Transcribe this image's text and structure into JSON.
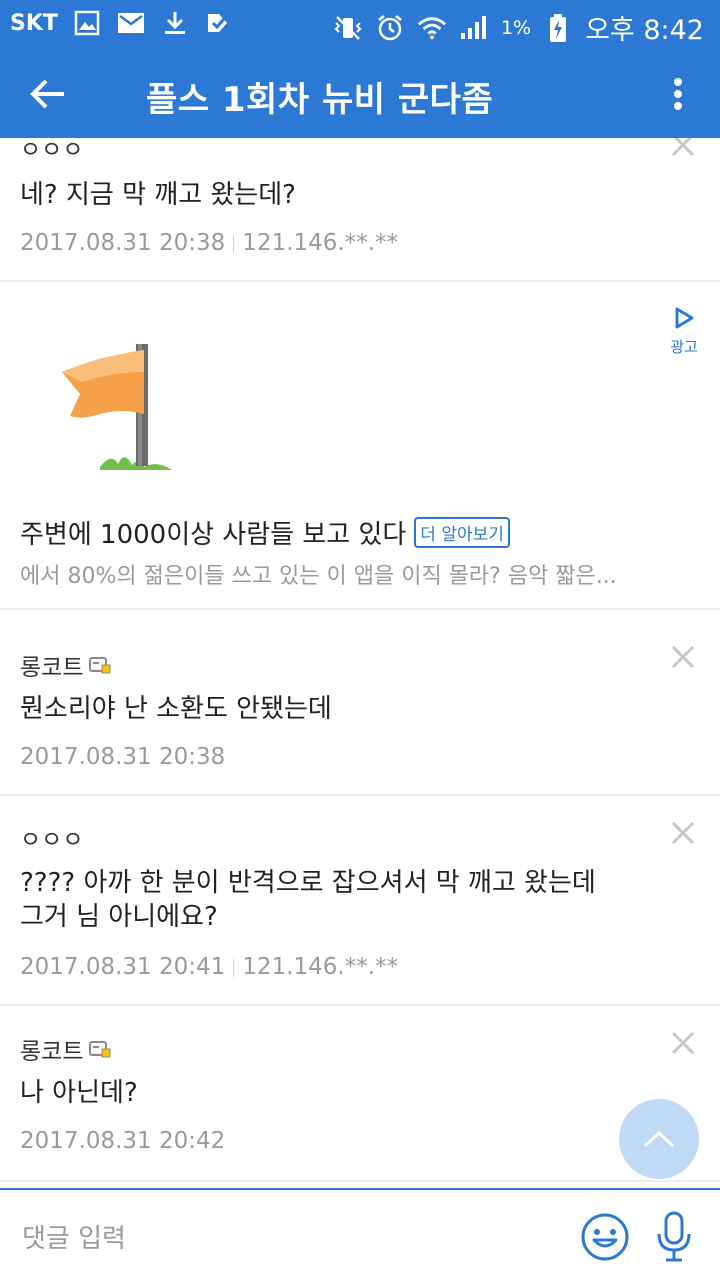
{
  "status_bar": {
    "carrier": "SKT",
    "battery": "1%",
    "time": "오후 8:42"
  },
  "app_bar": {
    "title": "플스 1회차 뉴비 군다좀"
  },
  "comments": [
    {
      "nick": "ㅇㅇㅇ",
      "text": "네? 지금 막 깨고 왔는데?",
      "date": "2017.08.31 20:38",
      "ip": "121.146.**.**"
    },
    {
      "nick": "롱코트",
      "text": "뭔소리야 난 소환도 안됐는데",
      "date": "2017.08.31 20:38"
    },
    {
      "nick": "ㅇㅇㅇ",
      "text_line1": "???? 아까 한 분이 반격으로 잡으셔서 막 깨고 왔는데",
      "text_line2": "그거 님 아니에요?",
      "date": "2017.08.31 20:41",
      "ip": "121.146.**.**"
    },
    {
      "nick": "롱코트",
      "text": "나 아닌데?",
      "date": "2017.08.31 20:42"
    }
  ],
  "ad": {
    "label": "광고",
    "headline": "주변에 1000이상 사람들 보고 있다",
    "cta": "더 알아보기",
    "description": "에서 80%의 젊은이들 쓰고 있는 이 앱을 이직 몰라? 음악 짧은..."
  },
  "input": {
    "placeholder": "댓글 입력"
  },
  "colors": {
    "primary": "#2b79d4",
    "meta_text": "#9a9a9a",
    "flag": "#f7a04a",
    "divider": "#ececec"
  }
}
